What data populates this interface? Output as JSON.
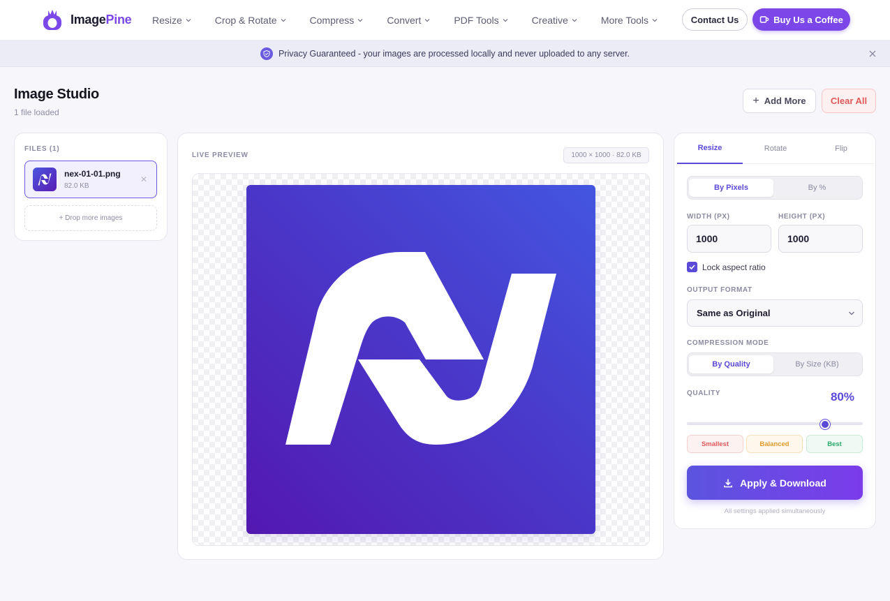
{
  "brand": {
    "name_part1": "Image",
    "name_part2": "Pine"
  },
  "nav": [
    {
      "label": "Resize"
    },
    {
      "label": "Crop & Rotate"
    },
    {
      "label": "Compress"
    },
    {
      "label": "Convert"
    },
    {
      "label": "PDF Tools"
    },
    {
      "label": "Creative"
    },
    {
      "label": "More Tools"
    }
  ],
  "header_actions": {
    "contact": "Contact Us",
    "coffee": "Buy Us a Coffee"
  },
  "banner": {
    "text": "Privacy Guaranteed - your images are processed locally and never uploaded to any server."
  },
  "studio": {
    "title": "Image Studio",
    "subtitle": "1 file loaded",
    "add_more": "Add More",
    "clear_all": "Clear All"
  },
  "files": {
    "label": "FILES (1)",
    "items": [
      {
        "name": "nex-01-01.png",
        "size": "82.0 KB"
      }
    ],
    "drop_more": "+ Drop more images"
  },
  "preview": {
    "label": "LIVE PREVIEW",
    "dimensions": "1000 × 1000 · 82.0 KB"
  },
  "settings": {
    "tabs": [
      {
        "label": "Resize"
      },
      {
        "label": "Rotate"
      },
      {
        "label": "Flip"
      }
    ],
    "active_tab": "Resize",
    "size_mode": {
      "options": [
        "By Pixels",
        "By %"
      ],
      "active": "By Pixels"
    },
    "width_label": "WIDTH (PX)",
    "height_label": "HEIGHT (PX)",
    "width": "1000",
    "height": "1000",
    "lock_aspect": "Lock aspect ratio",
    "lock_checked": true,
    "output_format_label": "OUTPUT FORMAT",
    "output_format": "Same as Original",
    "compression_label": "COMPRESSION MODE",
    "compression_mode": {
      "options": [
        "By Quality",
        "By Size (KB)"
      ],
      "active": "By Quality"
    },
    "quality_label": "QUALITY",
    "quality_value": "80%",
    "quality": 0.8,
    "presets": [
      "Smallest",
      "Balanced",
      "Best"
    ],
    "apply": "Apply & Download",
    "hint": "All settings applied simultaneously"
  },
  "colors": {
    "accent": "#7b47e8",
    "primary": "#5a4ad8",
    "danger": "#e0585a"
  }
}
